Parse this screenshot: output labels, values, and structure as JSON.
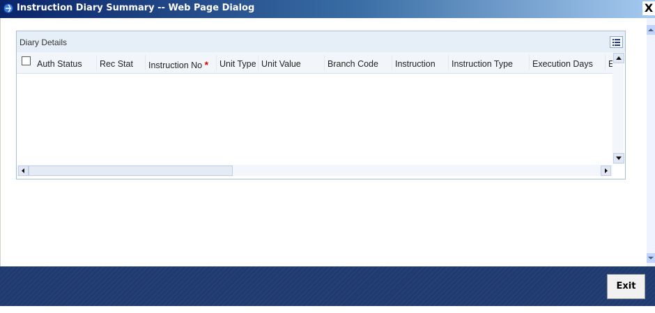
{
  "window": {
    "title": "Instruction Diary Summary -- Web Page Dialog",
    "close_glyph": "X"
  },
  "panel": {
    "caption": "Diary Details",
    "columns": [
      {
        "label": "Auth Status",
        "required": false
      },
      {
        "label": "Rec Stat",
        "required": false
      },
      {
        "label": "Instruction No",
        "required": true
      },
      {
        "label": "Unit Type",
        "required": false
      },
      {
        "label": "Unit Value",
        "required": false
      },
      {
        "label": "Branch Code",
        "required": false
      },
      {
        "label": "Instruction",
        "required": false
      },
      {
        "label": "Instruction Type",
        "required": false
      },
      {
        "label": "Execution Days",
        "required": false
      },
      {
        "label": "E",
        "required": false
      }
    ],
    "required_marker": "*",
    "rows": []
  },
  "footer": {
    "exit_label": "Exit"
  },
  "colors": {
    "titlebar_start": "#0a246a",
    "bottombar": "#1f3b6f",
    "required": "#e00000"
  }
}
